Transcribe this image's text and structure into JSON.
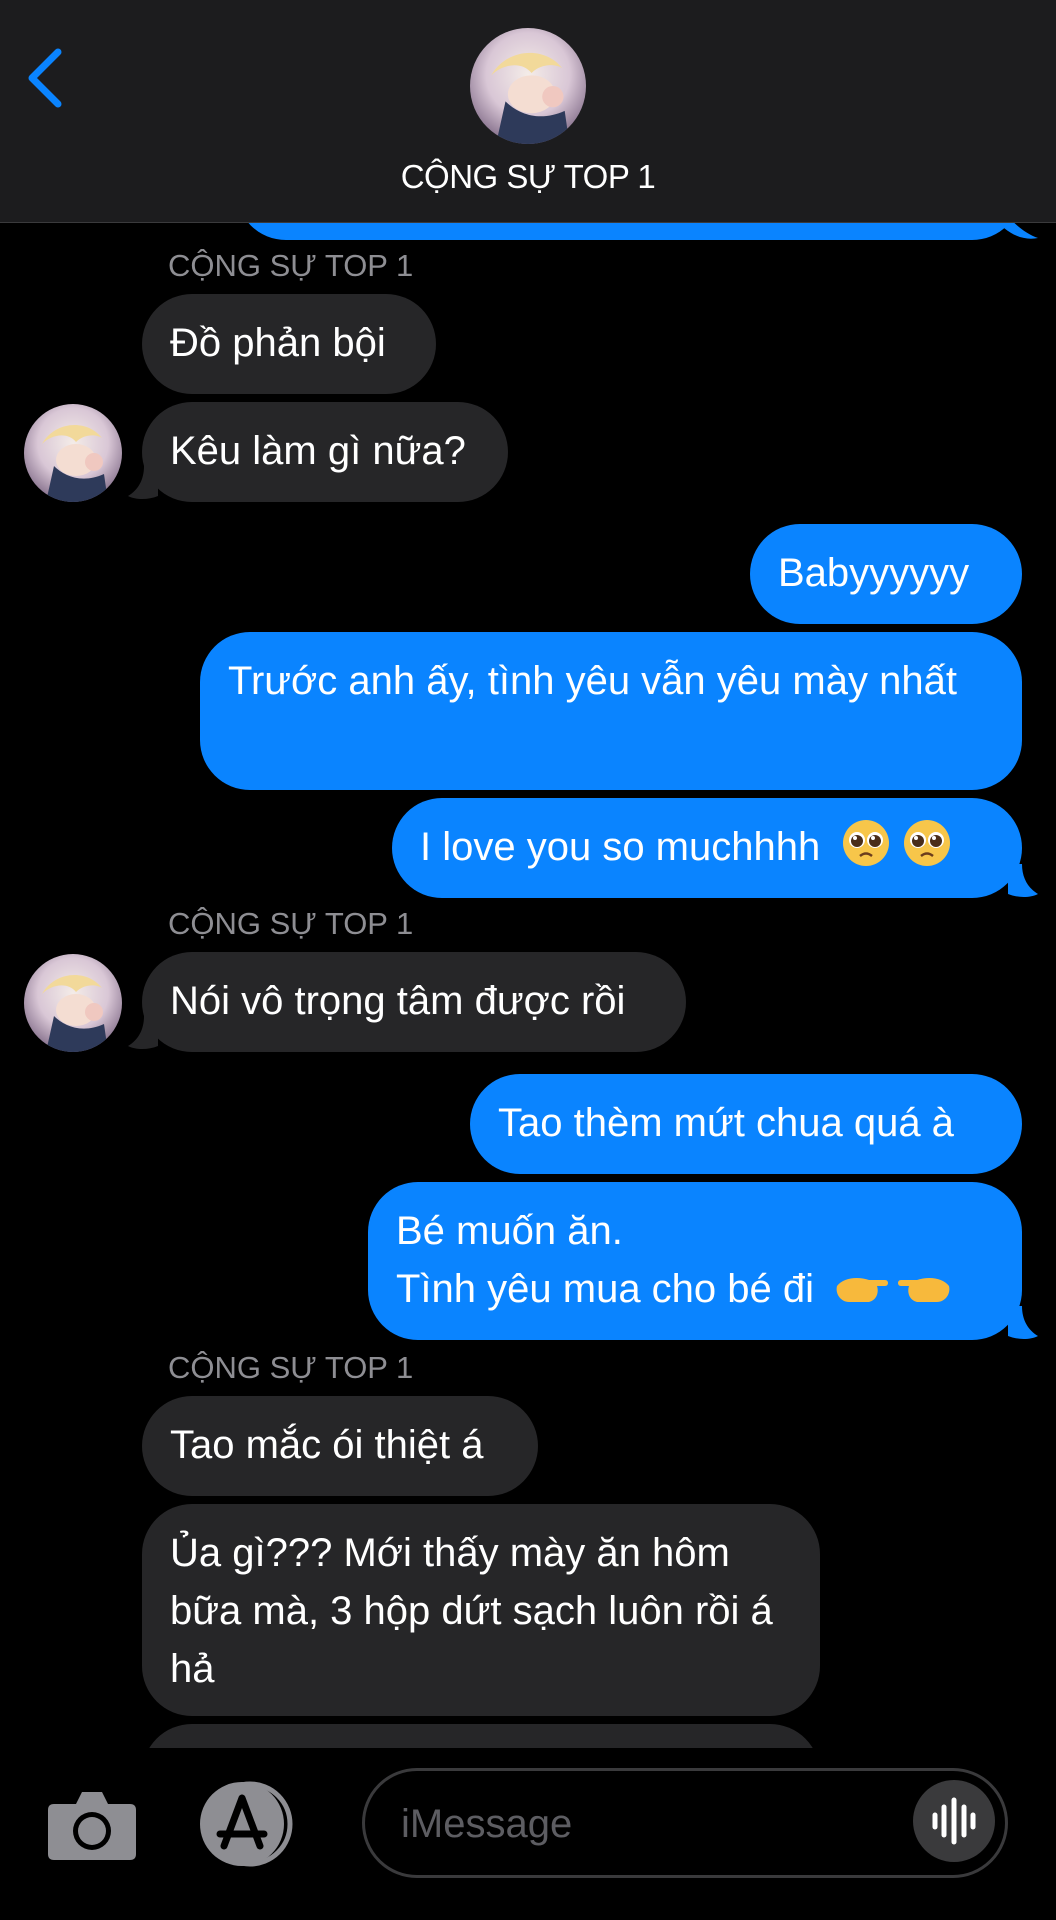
{
  "header": {
    "contact_name": "CỘNG SỰ TOP 1"
  },
  "thread": {
    "groups": [
      {
        "sender": "CỘNG SỰ TOP 1",
        "messages": [
          "Đồ phản bội",
          "Kêu làm gì nữa?"
        ]
      },
      {
        "sender": "me",
        "messages": [
          "Babyyyyyy",
          "Trước anh ấy, tình yêu vẫn yêu mày nhất",
          "I love you so muchhhh"
        ]
      },
      {
        "sender": "CỘNG SỰ TOP 1",
        "messages": [
          "Nói vô trọng tâm được rồi"
        ]
      },
      {
        "sender": "me",
        "messages": [
          "Tao thèm mứt chua quá à",
          "Bé muốn ăn.",
          "Tình yêu mua cho bé đi"
        ]
      },
      {
        "sender": "CỘNG SỰ TOP 1",
        "messages": [
          "Tao mắc ói thiệt á",
          "Ủa gì??? Mới thấy mày ăn hôm bữa mà, 3 hộp dứt sạch luôn rồi á hả"
        ]
      }
    ],
    "emojis": {
      "love_message": [
        "pleading-face",
        "pleading-face"
      ],
      "request_message": [
        "pointing-fingers"
      ]
    }
  },
  "composer": {
    "placeholder": "iMessage"
  },
  "colors": {
    "outgoing_bubble": "#0a84ff",
    "incoming_bubble": "#262628",
    "accent": "#0a84ff",
    "background": "#000000"
  }
}
